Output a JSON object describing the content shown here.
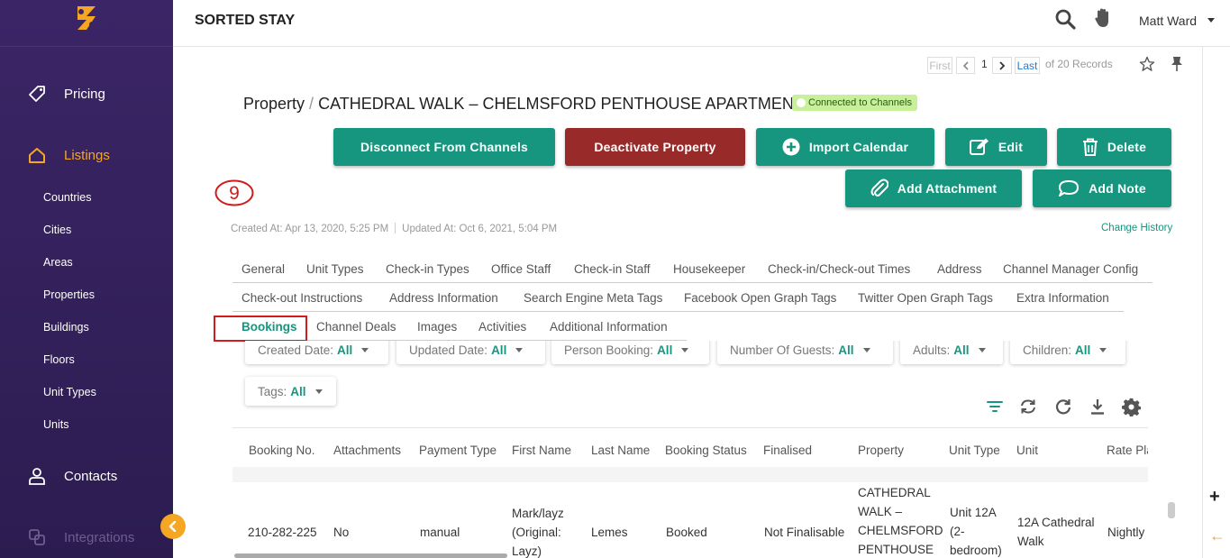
{
  "app": {
    "title": "SORTED STAY"
  },
  "user": {
    "name": "Matt Ward"
  },
  "sidebar": {
    "main": [
      {
        "label": "Pricing",
        "icon": "tag-icon"
      },
      {
        "label": "Listings",
        "icon": "home-icon",
        "active": true
      },
      {
        "label": "Contacts",
        "icon": "person-icon"
      },
      {
        "label": "Integrations",
        "icon": "integrations-icon"
      }
    ],
    "sub": [
      "Countries",
      "Cities",
      "Areas",
      "Properties",
      "Buildings",
      "Floors",
      "Unit Types",
      "Units"
    ]
  },
  "pager": {
    "first": "First",
    "current": "1",
    "last": "Last",
    "of_records": "of 20 Records"
  },
  "property": {
    "prefix": "Property",
    "separator": "/",
    "name": "CATHEDRAL WALK – CHELMSFORD PENTHOUSE APARTMENTS",
    "status_badge": "Connected to Channels"
  },
  "actions": {
    "disconnect": "Disconnect From Channels",
    "deactivate": "Deactivate Property",
    "import_calendar": "Import Calendar",
    "edit": "Edit",
    "delete": "Delete",
    "add_attachment": "Add Attachment",
    "add_note": "Add Note"
  },
  "annotation": "9",
  "meta": {
    "created": "Created At: Apr 13, 2020, 5:25 PM",
    "updated": "Updated At: Oct 6, 2021, 5:04 PM",
    "change_history": "Change History"
  },
  "tabs": {
    "row1": [
      "General",
      "Unit Types",
      "Check-in Types",
      "Office Staff",
      "Check-in Staff",
      "Housekeeper",
      "Check-in/Check-out Times",
      "Address",
      "Channel Manager Config"
    ],
    "row2": [
      "Check-out Instructions",
      "Address Information",
      "Search Engine Meta Tags",
      "Facebook Open Graph Tags",
      "Twitter Open Graph Tags",
      "Extra Information"
    ],
    "row3": [
      "Bookings",
      "Channel Deals",
      "Images",
      "Activities",
      "Additional Information"
    ],
    "active": "Bookings"
  },
  "filters": [
    {
      "label": "Created Date:",
      "value": "All"
    },
    {
      "label": "Updated Date:",
      "value": "All"
    },
    {
      "label": "Person Booking:",
      "value": "All"
    },
    {
      "label": "Number Of Guests:",
      "value": "All"
    },
    {
      "label": "Adults:",
      "value": "All"
    },
    {
      "label": "Children:",
      "value": "All"
    },
    {
      "label": "Tags:",
      "value": "All"
    }
  ],
  "table": {
    "headers": [
      "Booking No.",
      "Attachments",
      "Payment Type",
      "First Name",
      "Last Name",
      "Booking Status",
      "Finalised",
      "Property",
      "Unit Type",
      "Unit",
      "Rate Plan"
    ],
    "row": {
      "booking_no": "210-282-225",
      "attachments": "No",
      "payment_type": "manual",
      "first_name": "Mark/layz (Original: Layz)",
      "last_name": "Lemes",
      "booking_status": "Booked",
      "finalised": "Not Finalisable",
      "property": "CATHEDRAL WALK – CHELMSFORD PENTHOUSE APARTMENTS",
      "unit_type": "Unit 12A (2-bedroom)",
      "unit": "12A Cathedral Walk",
      "rate_plan": "Nightly"
    }
  },
  "colors": {
    "sidebar": "#3c2566",
    "accent": "#f5a623",
    "teal": "#16967e",
    "red": "#992a2a",
    "annotation": "#d01c1c"
  }
}
